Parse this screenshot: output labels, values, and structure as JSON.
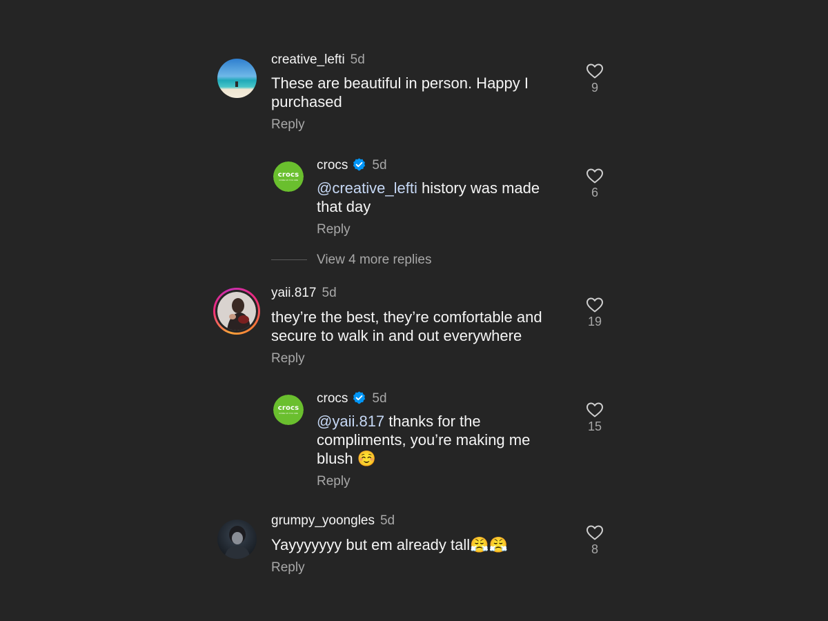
{
  "comments": [
    {
      "username": "creative_lefti",
      "time": "5d",
      "text": "These are beautiful in person. Happy I purchased",
      "reply": "Reply",
      "likes": "9"
    },
    {
      "username": "crocs",
      "time": "5d",
      "mention": "@creative_lefti",
      "text": " history was made that day",
      "reply": "Reply",
      "likes": "6",
      "logo_text": "crocs",
      "logo_tag": "COME AS YOU ARE"
    },
    {
      "view_more": "View 4 more replies"
    },
    {
      "username": "yaii.817",
      "time": "5d",
      "text": "they’re the best, they’re comfortable and secure to walk in and out everywhere",
      "reply": "Reply",
      "likes": "19"
    },
    {
      "username": "crocs",
      "time": "5d",
      "mention": "@yaii.817",
      "text": " thanks for the compliments, you’re making me blush ☺️",
      "reply": "Reply",
      "likes": "15",
      "logo_text": "crocs",
      "logo_tag": "COME AS YOU ARE"
    },
    {
      "username": "grumpy_yoongles",
      "time": "5d",
      "text": "Yayyyyyyy but em already tall😤😤",
      "reply": "Reply",
      "likes": "8"
    }
  ],
  "icons": {
    "like": "heart-outline-icon",
    "verified": "verified-badge-icon"
  },
  "colors": {
    "background": "#252525",
    "crocs_green": "#6abf2e",
    "verified_blue": "#0095f6",
    "mention": "#c6d8f5",
    "muted": "#a8a8a8"
  }
}
